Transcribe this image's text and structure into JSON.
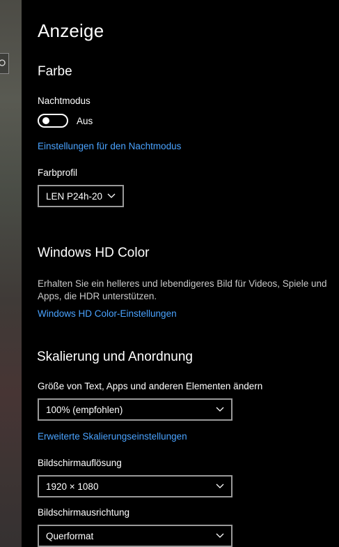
{
  "page": {
    "title": "Anzeige"
  },
  "farbe": {
    "heading": "Farbe",
    "nachtmodus_label": "Nachtmodus",
    "toggle_state": "Aus",
    "toggle_on": false,
    "nachtmodus_link": "Einstellungen für den Nachtmodus",
    "farbprofil_label": "Farbprofil",
    "farbprofil_value": "LEN P24h-20"
  },
  "hdr": {
    "heading": "Windows HD Color",
    "description": "Erhalten Sie ein helleres und lebendigeres Bild für Videos, Spiele und Apps, die HDR unterstützen.",
    "link": "Windows HD Color-Einstellungen"
  },
  "scaling": {
    "heading": "Skalierung und Anordnung",
    "size_label": "Größe von Text, Apps und anderen Elementen ändern",
    "size_value": "100% (empfohlen)",
    "advanced_link": "Erweiterte Skalierungseinstellungen",
    "resolution_label": "Bildschirmauflösung",
    "resolution_value": "1920 × 1080",
    "orientation_label": "Bildschirmausrichtung",
    "orientation_value": "Querformat"
  },
  "colors": {
    "accent_link": "#4aa3ff",
    "background": "#000000"
  }
}
